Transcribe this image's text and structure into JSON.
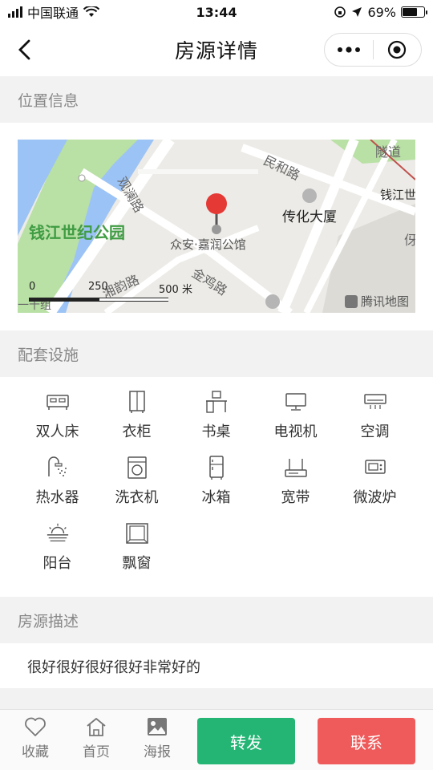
{
  "status_bar": {
    "carrier": "中国联通",
    "time": "13:44",
    "battery": "69%",
    "battery_level": 0.69
  },
  "nav": {
    "title": "房源详情"
  },
  "sections": {
    "location": "位置信息",
    "facilities": "配套设施",
    "description": "房源描述"
  },
  "map": {
    "marker_label": "众安·嘉润公馆",
    "roads": [
      "民和路",
      "观澜路",
      "金鸡路",
      "湘韵路",
      "隧道"
    ],
    "pois": [
      "传化大厦",
      "钱江世"
    ],
    "park": "钱江世纪公园",
    "scale_labels": [
      "0",
      "250",
      "500 米"
    ],
    "brand": "腾讯地图",
    "misc": [
      "一十组",
      "伢"
    ]
  },
  "facilities": [
    {
      "label": "双人床",
      "icon": "double-bed-icon"
    },
    {
      "label": "衣柜",
      "icon": "wardrobe-icon"
    },
    {
      "label": "书桌",
      "icon": "desk-icon"
    },
    {
      "label": "电视机",
      "icon": "tv-icon"
    },
    {
      "label": "空调",
      "icon": "air-conditioner-icon"
    },
    {
      "label": "热水器",
      "icon": "water-heater-icon"
    },
    {
      "label": "洗衣机",
      "icon": "washing-machine-icon"
    },
    {
      "label": "冰箱",
      "icon": "fridge-icon"
    },
    {
      "label": "宽带",
      "icon": "router-icon"
    },
    {
      "label": "微波炉",
      "icon": "microwave-icon"
    },
    {
      "label": "阳台",
      "icon": "balcony-icon"
    },
    {
      "label": "飘窗",
      "icon": "bay-window-icon"
    }
  ],
  "description": "很好很好很好很好非常好的",
  "bottom_bar": {
    "tabs": [
      {
        "label": "收藏",
        "icon": "heart-icon"
      },
      {
        "label": "首页",
        "icon": "home-icon"
      },
      {
        "label": "海报",
        "icon": "image-icon"
      }
    ],
    "share_label": "转发",
    "contact_label": "联系"
  },
  "colors": {
    "section_bg": "#f2f2f2",
    "share_button": "#24b574",
    "contact_button": "#ef5a5a",
    "marker": "#e53935",
    "park": "#b9e0a5",
    "water": "#9cc3f5"
  }
}
